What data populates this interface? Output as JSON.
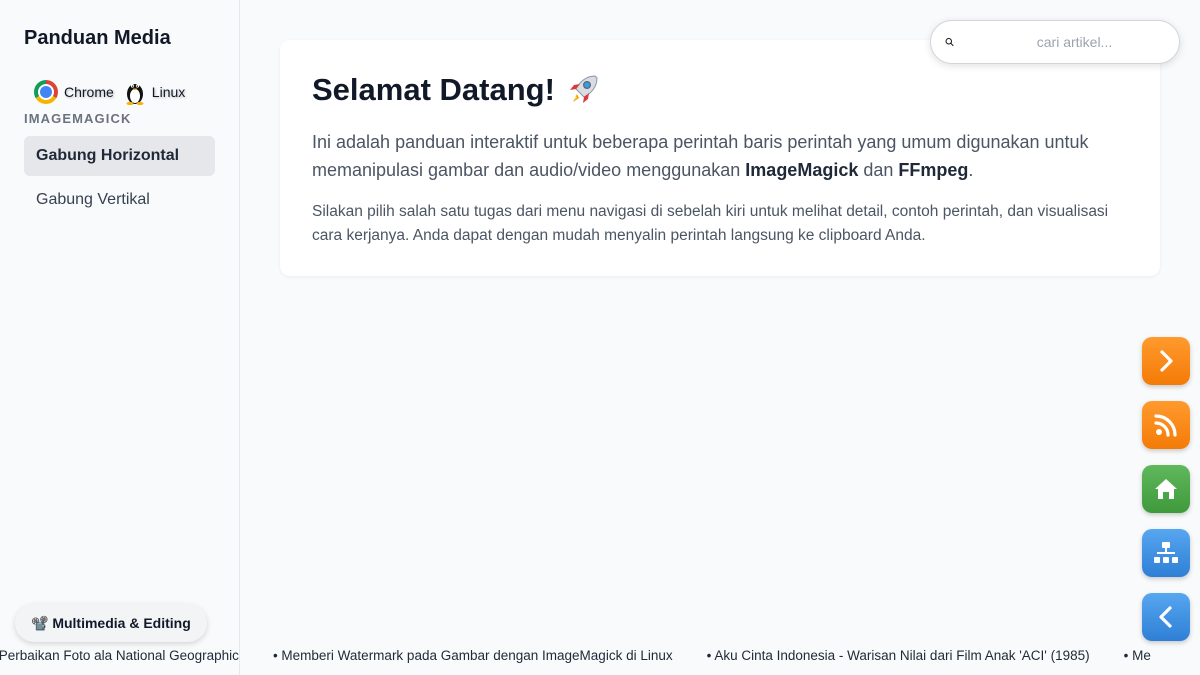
{
  "sidebar": {
    "title": "Panduan Media",
    "platforms": [
      {
        "icon": "chrome-icon",
        "label": "Chrome"
      },
      {
        "icon": "linux-penguin-icon",
        "label": "Linux"
      }
    ],
    "section_label": "IMAGEMAGICK",
    "items": [
      {
        "label": "Gabung Horizontal",
        "active": true
      },
      {
        "label": "Gabung Vertikal",
        "active": false
      }
    ],
    "category_pill": {
      "icon": "video-camera-icon",
      "label": "📽️ Multimedia & Editing"
    }
  },
  "search": {
    "placeholder": "cari artikel...",
    "value": ""
  },
  "main": {
    "title": "Selamat Datang!",
    "title_icon": "rocket-icon",
    "lead_prefix": "Ini adalah panduan interaktif untuk beberapa perintah baris perintah yang umum digunakan untuk memanipulasi gambar dan audio/video menggunakan ",
    "lead_tool1": "ImageMagick",
    "lead_and": " dan ",
    "lead_tool2": "FFmpeg",
    "lead_suffix": ".",
    "sub": "Silakan pilih salah satu tugas dari menu navigasi di sebelah kiri untuk melihat detail, contoh perintah, dan visualisasi cara kerjanya. Anda dapat dengan mudah menyalin perintah langsung ke clipboard Anda."
  },
  "floating_buttons": [
    {
      "icon": "chevron-right-icon",
      "color": "#f7860f"
    },
    {
      "icon": "rss-icon",
      "color": "#f7860f"
    },
    {
      "icon": "home-icon",
      "color": "#4caa49"
    },
    {
      "icon": "sitemap-icon",
      "color": "#3f8fe3"
    },
    {
      "icon": "chevron-left-icon",
      "color": "#3f8fe3"
    }
  ],
  "ticker": [
    "duan Perbaikan Foto ala National Geographic",
    "Memberi Watermark pada Gambar dengan ImageMagick di Linux",
    "Aku Cinta Indonesia - Warisan Nilai dari Film Anak 'ACI' (1985)",
    "Me"
  ]
}
